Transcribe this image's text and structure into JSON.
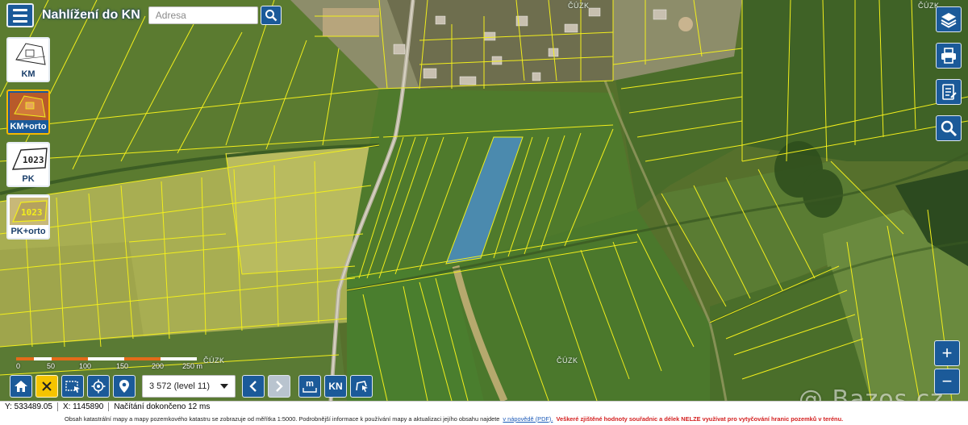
{
  "app": {
    "title": "Nahlížení do KN"
  },
  "search": {
    "placeholder": "Adresa",
    "value": "",
    "icon": "search-icon"
  },
  "layers": [
    {
      "label": "KM",
      "icon": "km-map-icon",
      "active": false
    },
    {
      "label": "KM+orto",
      "icon": "km-orto-icon",
      "active": true
    },
    {
      "label": "PK",
      "icon": "pk-map-icon",
      "active": false
    },
    {
      "label": "PK+orto",
      "icon": "pk-orto-icon",
      "active": false
    }
  ],
  "right_tools": [
    {
      "name": "layers",
      "icon": "layers-icon"
    },
    {
      "name": "print",
      "icon": "printer-icon"
    },
    {
      "name": "notes",
      "icon": "document-icon"
    },
    {
      "name": "search",
      "icon": "magnifier-icon"
    }
  ],
  "zoom": {
    "in": "+",
    "out": "−"
  },
  "scale": {
    "ticks": [
      "0",
      "50",
      "100",
      "150",
      "200",
      "250 m"
    ]
  },
  "watermarks": [
    "ČÚZK",
    "ČÚZK",
    "ČÚZK",
    "ČÚZK"
  ],
  "bottom_toolbar": {
    "level": "3 572 (level 11)",
    "measure_label": "m",
    "kn_label": "KN"
  },
  "status": {
    "y_label": "Y: 533489.05",
    "x_label": "X: 1145890",
    "loading": "Načítání dokončeno 12 ms"
  },
  "info": {
    "text": "Obsah katastrální mapy a mapy pozemkového katastru se zobrazuje od měřítka 1:5000. Podrobnější informace k používání mapy a aktualizaci jejího obsahu najdete",
    "link": "v nápovědě (PDF).",
    "warning": "Veškeré zjištěné hodnoty souřadnic a délek NELZE využívat pro vytyčování hranic pozemků v terénu."
  },
  "watermark_site": "@ Bazos.cz",
  "colors": {
    "primary": "#1b5a99",
    "parcel_lines": "#f2ee1c",
    "selected_parcel": "#4a90d9",
    "field_green": "#5f7d34",
    "active_layer_border": "#f5b800",
    "reset_button": "#f5c400",
    "warning_text": "#d42020"
  }
}
